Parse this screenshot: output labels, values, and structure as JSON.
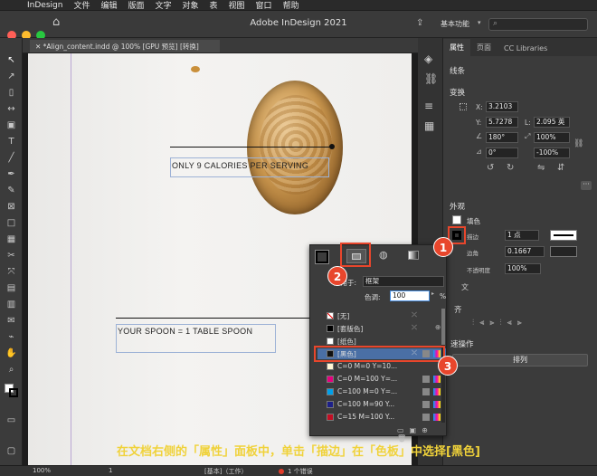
{
  "menu": {
    "app": "InDesign",
    "items": [
      "文件",
      "编辑",
      "版面",
      "文字",
      "对象",
      "表",
      "视图",
      "窗口",
      "帮助"
    ]
  },
  "titlebar": {
    "title": "Adobe InDesign 2021",
    "workspace": "基本功能"
  },
  "doc_tab": {
    "label": "*Align_content.indd @ 100% [GPU 预览] [转换]"
  },
  "canvas": {
    "text1": "ONLY 9 CALORIES PER SERVING",
    "text2": "YOUR SPOON = 1 TABLE SPOON"
  },
  "panel": {
    "tabs": [
      "属性",
      "页面",
      "CC Libraries"
    ],
    "section_line": "线条",
    "section_transform": "变换",
    "x_label": "X:",
    "x_value": "3.2103",
    "y_label": "Y:",
    "y_value": "5.7278",
    "w_label": "W:",
    "w_value": "",
    "l_label": "L:",
    "l_value": "2.095 英",
    "angle": "180°",
    "scale1": "100%",
    "angle2": "0°",
    "scale2": "-100%",
    "section_appearance": "外观",
    "fill_label": "填色",
    "stroke_label": "描边",
    "stroke_weight": "1 点",
    "corner_label": "边角",
    "corner_value": "0.1667",
    "opacity_label": "不透明度",
    "opacity_value": "100%",
    "text_label": "文",
    "align_label": "齐",
    "quick_label": "速操作",
    "arrange_button": "排列"
  },
  "popup": {
    "apply_label": "应用于:",
    "apply_value": "框架",
    "tint_label": "色调:",
    "tint_value": "100",
    "tint_unit": "%",
    "swatches": [
      {
        "name": "[无]",
        "color": "none"
      },
      {
        "name": "[套版色]",
        "color": "#000000"
      },
      {
        "name": "[纸色]",
        "color": "#ffffff"
      },
      {
        "name": "[黑色]",
        "color": "#111111"
      },
      {
        "name": "C=0 M=0 Y=10...",
        "color": "#fff7d6"
      },
      {
        "name": "C=0 M=100 Y=...",
        "color": "#e6007e"
      },
      {
        "name": "C=100 M=0 Y=...",
        "color": "#00a0e9"
      },
      {
        "name": "C=100 M=90 Y...",
        "color": "#1d2088"
      },
      {
        "name": "C=15 M=100 Y...",
        "color": "#c30d23"
      }
    ]
  },
  "status": {
    "zoom": "100%",
    "page": "1",
    "base": "[基本]（工作）",
    "errors": "1 个错误"
  },
  "badges": [
    "1",
    "2",
    "3"
  ],
  "caption": "在文档右侧的「属性」面板中，单击「描边」在「色板」中选择[黑色]",
  "colors": {
    "accent": "#e8462c",
    "caption": "#f0d23a"
  }
}
